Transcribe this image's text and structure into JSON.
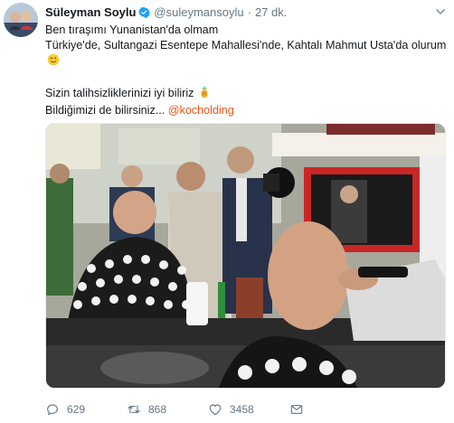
{
  "tweet": {
    "author_name": "Süleyman Soylu",
    "handle": "@suleymansoylu",
    "separator": "·",
    "time": "27 dk.",
    "lines": [
      "Ben tıraşımı Yunanistan'da olmam",
      "Türkiye'de, Sultangazi Esentepe Mahallesi'nde, Kahtalı Mahmut Usta'da olurum"
    ],
    "line3": "Sizin talihsizliklerinizi iyi biliriz",
    "line4_text": "Bildiğimizi de bilirsiniz... ",
    "line4_mention": "@kocholding",
    "emoji_wink": "wink-emoji",
    "emoji_pineapple": "pineapple-emoji"
  },
  "actions": {
    "reply_count": "629",
    "retweet_count": "868",
    "like_count": "3458"
  },
  "colors": {
    "text": "#14171a",
    "secondary": "#657786",
    "mention": "#e8561e",
    "verified": "#1da1f2"
  },
  "icons": [
    "verified-badge-icon",
    "caret-down-icon",
    "reply-icon",
    "retweet-icon",
    "like-icon",
    "message-icon"
  ]
}
